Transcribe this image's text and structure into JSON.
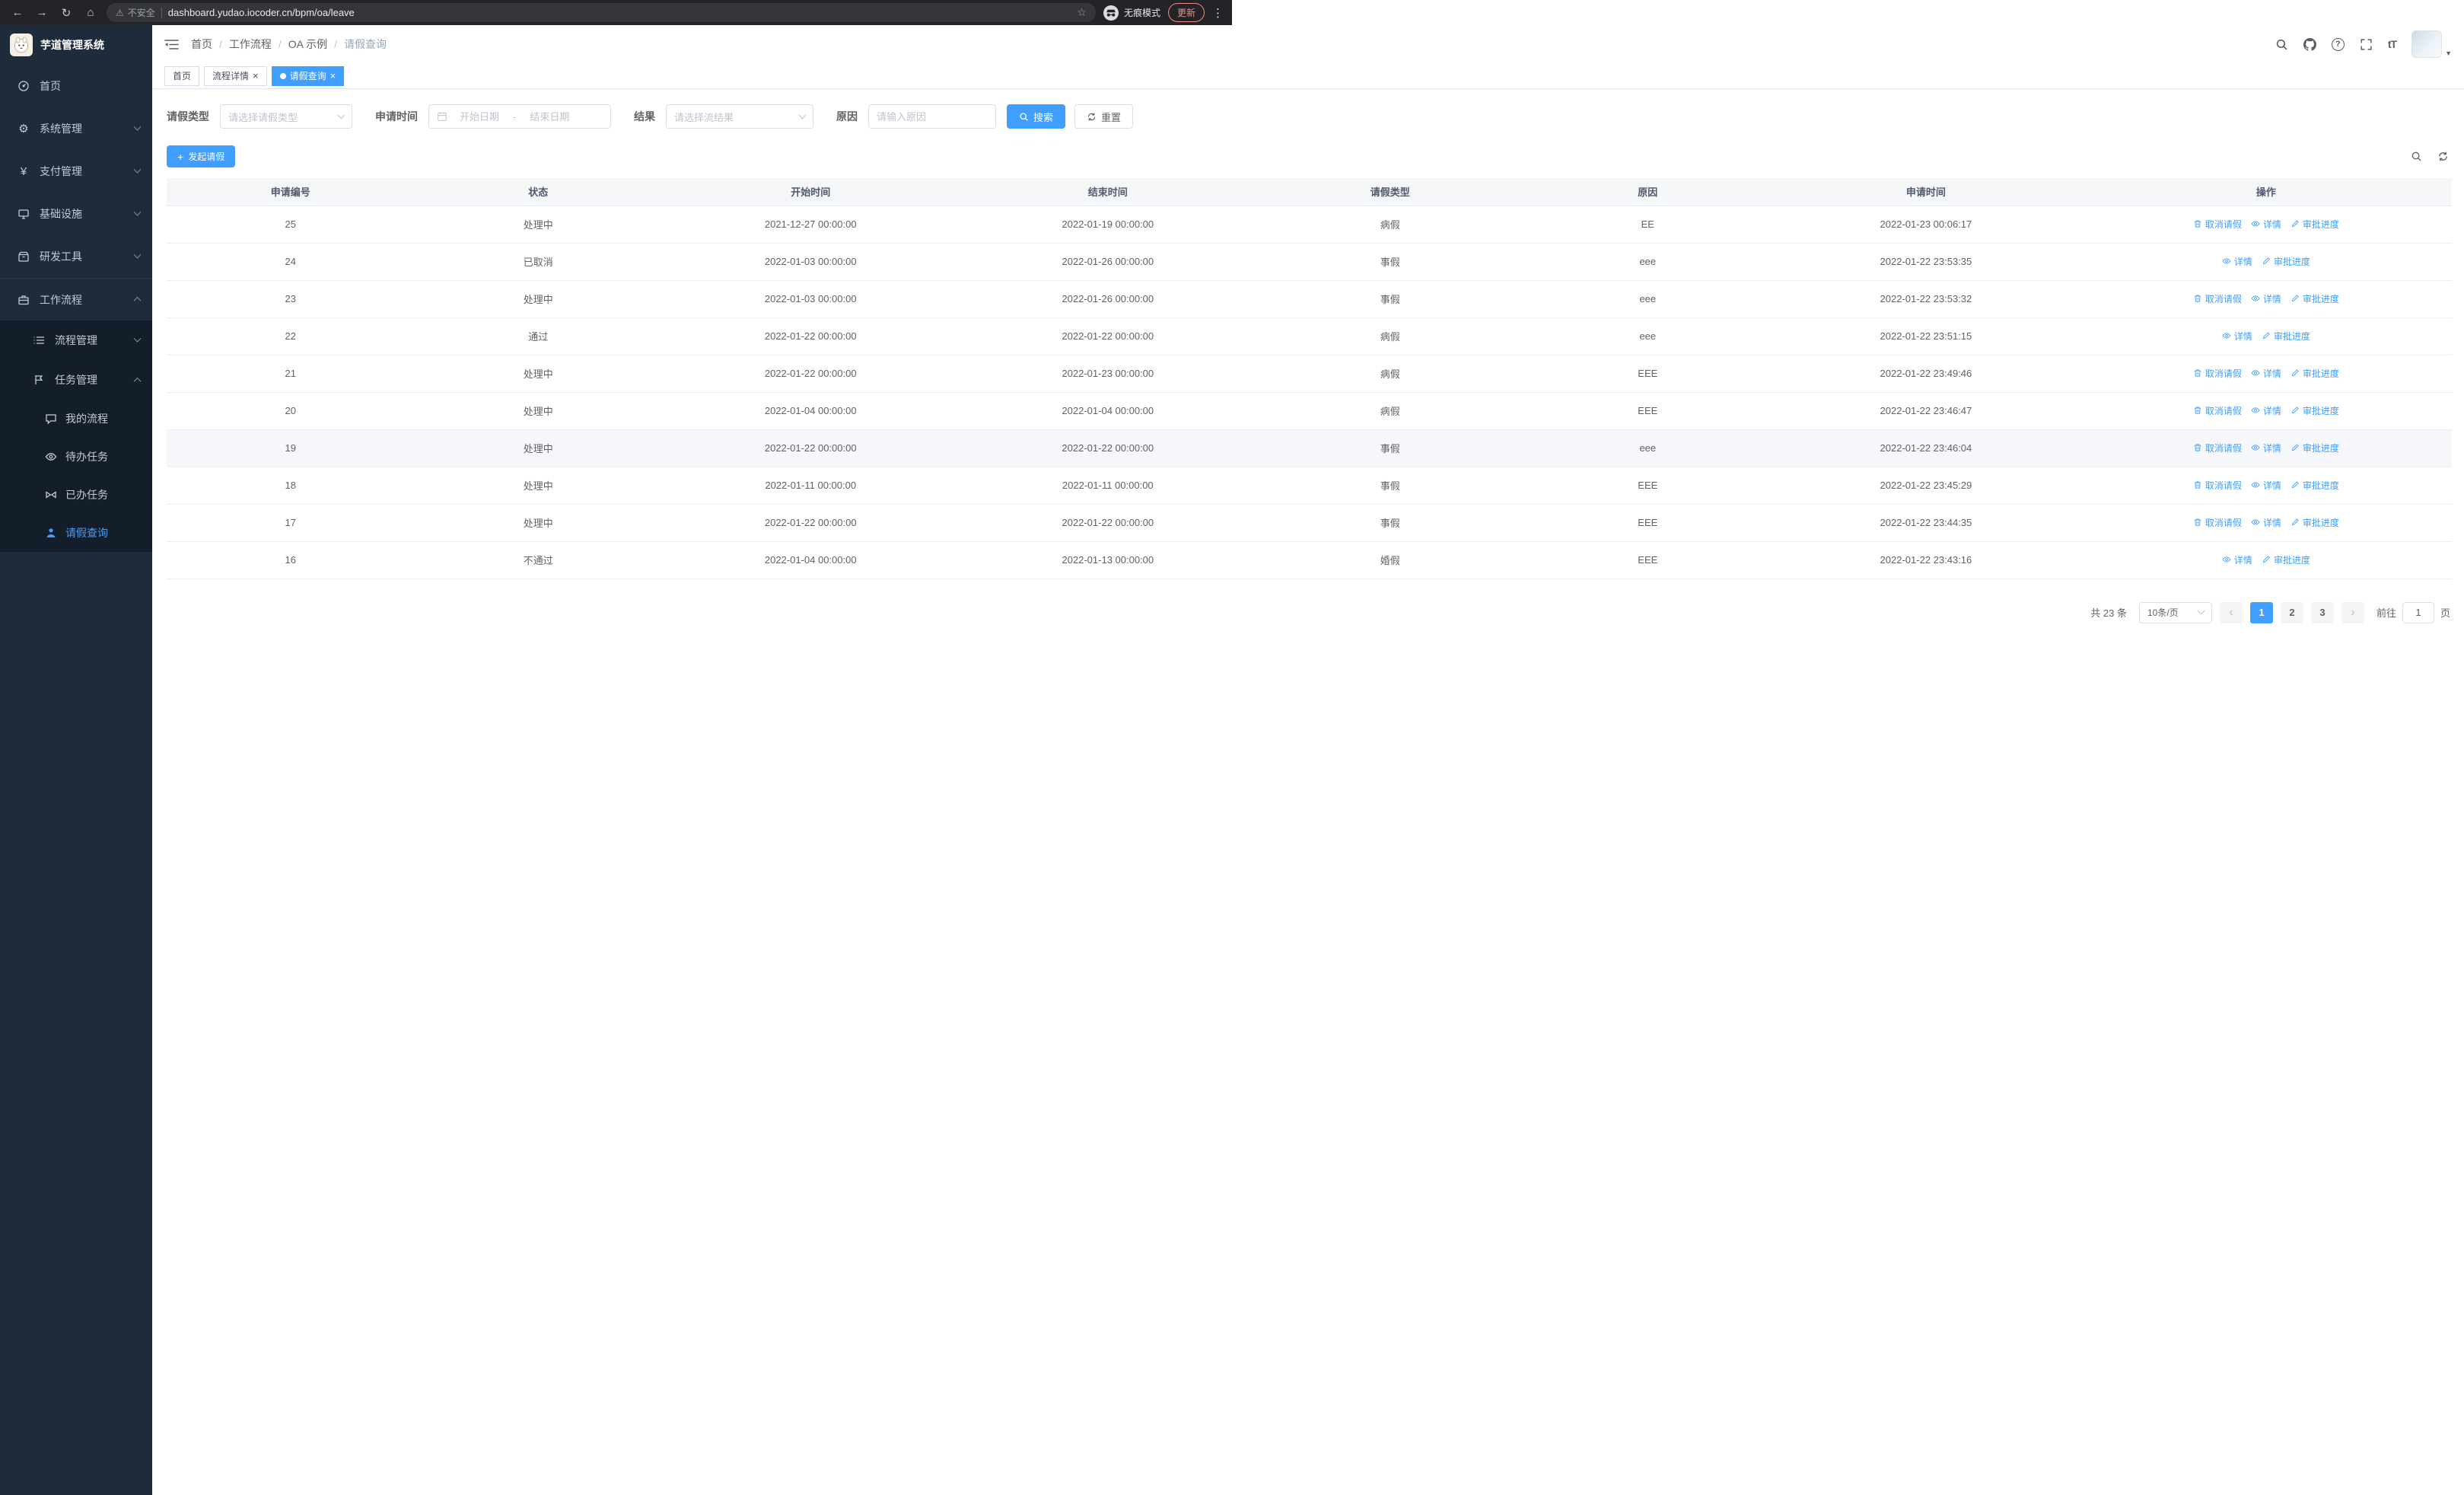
{
  "browser": {
    "security_warning": "不安全",
    "url": "dashboard.yudao.iocoder.cn/bpm/oa/leave",
    "incognito_label": "无痕模式",
    "update_label": "更新"
  },
  "icons": {
    "back": "←",
    "forward": "→",
    "reload": "↻",
    "home": "⌂",
    "warning": "⚠",
    "star": "☆",
    "kebab": "⋮",
    "caret_down": "▼",
    "help": "?",
    "font_size": "tT",
    "plus": "+",
    "close": "×",
    "breadcrumb_separator": "/",
    "prev": "‹",
    "next": "›",
    "gear": "⚙",
    "yen": "¥"
  },
  "sidebar": {
    "title": "芋道管理系统",
    "items": [
      {
        "label": "首页"
      },
      {
        "label": "系统管理"
      },
      {
        "label": "支付管理"
      },
      {
        "label": "基础设施"
      },
      {
        "label": "研发工具"
      },
      {
        "label": "工作流程"
      }
    ],
    "workflow_children": [
      {
        "label": "流程管理"
      },
      {
        "label": "任务管理"
      }
    ],
    "task_children": [
      {
        "label": "我的流程"
      },
      {
        "label": "待办任务"
      },
      {
        "label": "已办任务"
      },
      {
        "label": "请假查询"
      }
    ]
  },
  "header": {
    "breadcrumb": [
      "首页",
      "工作流程",
      "OA 示例",
      "请假查询"
    ]
  },
  "tabs": [
    {
      "label": "首页",
      "closable": false,
      "active": false
    },
    {
      "label": "流程详情",
      "closable": true,
      "active": false
    },
    {
      "label": "请假查询",
      "closable": true,
      "active": true
    }
  ],
  "filters": {
    "leave_type_label": "请假类型",
    "leave_type_placeholder": "请选择请假类型",
    "apply_time_label": "申请时间",
    "start_date_placeholder": "开始日期",
    "range_separator": "-",
    "end_date_placeholder": "结束日期",
    "result_label": "结果",
    "result_placeholder": "请选择流结果",
    "reason_label": "原因",
    "reason_placeholder": "请输入原因",
    "search_button": "搜索",
    "reset_button": "重置"
  },
  "toolbar": {
    "create_button": "发起请假"
  },
  "table": {
    "columns": [
      "申请编号",
      "状态",
      "开始时间",
      "结束时间",
      "请假类型",
      "原因",
      "申请时间",
      "操作"
    ],
    "action_labels": {
      "cancel": "取消请假",
      "detail": "详情",
      "progress": "审批进度"
    },
    "rows": [
      {
        "id": "25",
        "status": "处理中",
        "start": "2021-12-27 00:00:00",
        "end": "2022-01-19 00:00:00",
        "type": "病假",
        "reason": "EE",
        "applied": "2022-01-23 00:06:17",
        "actions": [
          "cancel",
          "detail",
          "progress"
        ],
        "hovered": false
      },
      {
        "id": "24",
        "status": "已取消",
        "start": "2022-01-03 00:00:00",
        "end": "2022-01-26 00:00:00",
        "type": "事假",
        "reason": "eee",
        "applied": "2022-01-22 23:53:35",
        "actions": [
          "detail",
          "progress"
        ],
        "hovered": false
      },
      {
        "id": "23",
        "status": "处理中",
        "start": "2022-01-03 00:00:00",
        "end": "2022-01-26 00:00:00",
        "type": "事假",
        "reason": "eee",
        "applied": "2022-01-22 23:53:32",
        "actions": [
          "cancel",
          "detail",
          "progress"
        ],
        "hovered": false
      },
      {
        "id": "22",
        "status": "通过",
        "start": "2022-01-22 00:00:00",
        "end": "2022-01-22 00:00:00",
        "type": "病假",
        "reason": "eee",
        "applied": "2022-01-22 23:51:15",
        "actions": [
          "detail",
          "progress"
        ],
        "hovered": false
      },
      {
        "id": "21",
        "status": "处理中",
        "start": "2022-01-22 00:00:00",
        "end": "2022-01-23 00:00:00",
        "type": "病假",
        "reason": "EEE",
        "applied": "2022-01-22 23:49:46",
        "actions": [
          "cancel",
          "detail",
          "progress"
        ],
        "hovered": false
      },
      {
        "id": "20",
        "status": "处理中",
        "start": "2022-01-04 00:00:00",
        "end": "2022-01-04 00:00:00",
        "type": "病假",
        "reason": "EEE",
        "applied": "2022-01-22 23:46:47",
        "actions": [
          "cancel",
          "detail",
          "progress"
        ],
        "hovered": false
      },
      {
        "id": "19",
        "status": "处理中",
        "start": "2022-01-22 00:00:00",
        "end": "2022-01-22 00:00:00",
        "type": "事假",
        "reason": "eee",
        "applied": "2022-01-22 23:46:04",
        "actions": [
          "cancel",
          "detail",
          "progress"
        ],
        "hovered": true
      },
      {
        "id": "18",
        "status": "处理中",
        "start": "2022-01-11 00:00:00",
        "end": "2022-01-11 00:00:00",
        "type": "事假",
        "reason": "EEE",
        "applied": "2022-01-22 23:45:29",
        "actions": [
          "cancel",
          "detail",
          "progress"
        ],
        "hovered": false
      },
      {
        "id": "17",
        "status": "处理中",
        "start": "2022-01-22 00:00:00",
        "end": "2022-01-22 00:00:00",
        "type": "事假",
        "reason": "EEE",
        "applied": "2022-01-22 23:44:35",
        "actions": [
          "cancel",
          "detail",
          "progress"
        ],
        "hovered": false
      },
      {
        "id": "16",
        "status": "不通过",
        "start": "2022-01-04 00:00:00",
        "end": "2022-01-13 00:00:00",
        "type": "婚假",
        "reason": "EEE",
        "applied": "2022-01-22 23:43:16",
        "actions": [
          "detail",
          "progress"
        ],
        "hovered": false
      }
    ]
  },
  "pagination": {
    "total_text": "共 23 条",
    "page_size": "10条/页",
    "pages": [
      "1",
      "2",
      "3"
    ],
    "active_page": "1",
    "goto_label": "前往",
    "goto_value": "1",
    "page_suffix": "页"
  },
  "colors": {
    "primary": "#409eff",
    "sidebar_bg": "#1d2b3a",
    "sidebar_submenu_bg": "#141e2a",
    "update_pill": "#f28b82"
  }
}
